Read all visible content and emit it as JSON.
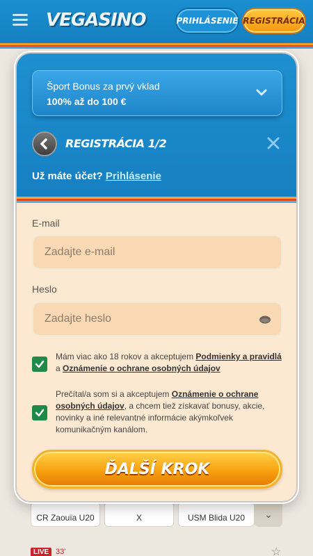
{
  "header": {
    "logo": "VEGASINO",
    "login_label": "PRIHLÁSENIE",
    "register_label": "REGISTRÁCIA"
  },
  "background": {
    "teams": [
      "CR Zaouïa U20",
      "X",
      "USM Blida U20"
    ],
    "live_label": "LIVE",
    "live_minute": "33'"
  },
  "modal": {
    "bonus": {
      "title": "Šport Bonus za prvý vklad",
      "value": "100% až do 100 €"
    },
    "step_title": "REGISTRÁCIA 1/",
    "step_num": "2",
    "account_question": "Už máte účet?",
    "account_link": "Prihlásenie",
    "email": {
      "label": "E-mail",
      "placeholder": "Zadajte e-mail"
    },
    "password": {
      "label": "Heslo",
      "placeholder": "Zadajte heslo"
    },
    "consent1": {
      "text_a": "Mám viac ako 18 rokov a akceptujem ",
      "link_a": "Podmienky a pravidlá",
      "text_b": " a ",
      "link_b": "Oznámenie o ochrane osobných údajov"
    },
    "consent2": {
      "text_a": "Prečítal/a som si a akceptujem ",
      "link_a": "Oznámenie o ochrane osobných údajov",
      "text_b": ", a chcem tiež získavať bonusy, akcie, novinky a iné relevantné informácie akýmkoľvek komunikačným kanálom."
    },
    "next_label": "ĎALŠÍ KROK"
  },
  "colors": {
    "header_blue": "#1a8fd0",
    "form_bg": "#fde9d2",
    "checkbox_green": "#1e8a4a",
    "cta_orange": "#f7a10f"
  }
}
